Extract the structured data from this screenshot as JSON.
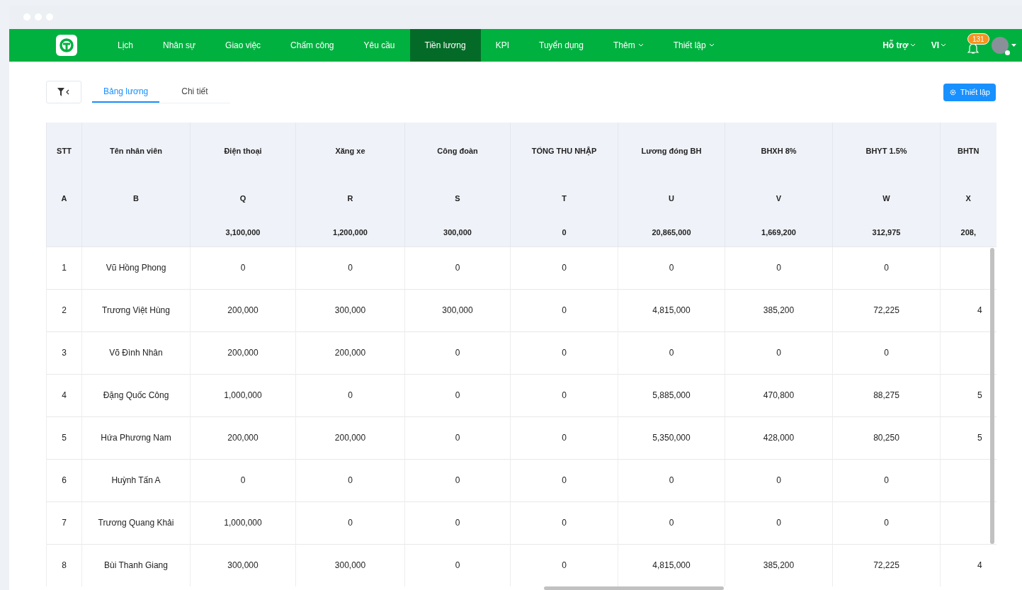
{
  "nav": {
    "items": [
      {
        "label": "Lịch",
        "selected": false,
        "has_menu": false
      },
      {
        "label": "Nhân sự",
        "selected": false,
        "has_menu": false
      },
      {
        "label": "Giao việc",
        "selected": false,
        "has_menu": false
      },
      {
        "label": "Chấm công",
        "selected": false,
        "has_menu": false
      },
      {
        "label": "Yêu cầu",
        "selected": false,
        "has_menu": false
      },
      {
        "label": "Tiền lương",
        "selected": true,
        "has_menu": false
      },
      {
        "label": "KPI",
        "selected": false,
        "has_menu": false
      },
      {
        "label": "Tuyển dụng",
        "selected": false,
        "has_menu": false
      },
      {
        "label": "Thêm",
        "selected": false,
        "has_menu": true
      },
      {
        "label": "Thiết lập",
        "selected": false,
        "has_menu": true
      }
    ],
    "right": [
      {
        "label": "Hỗ trợ"
      },
      {
        "label": "VI"
      }
    ],
    "notification_count": "131"
  },
  "tabs": [
    {
      "label": "Bảng lương",
      "selected": true
    },
    {
      "label": "Chi tiết",
      "selected": false
    }
  ],
  "settings_button": "Thiết lập",
  "table": {
    "columns": [
      {
        "title": "STT",
        "letter": "A"
      },
      {
        "title": "Tên nhân viên",
        "letter": "B"
      },
      {
        "title": "Điện thoại",
        "letter": "Q",
        "total": "3,100,000"
      },
      {
        "title": "Xăng xe",
        "letter": "R",
        "total": "1,200,000"
      },
      {
        "title": "Công đoàn",
        "letter": "S",
        "total": "300,000"
      },
      {
        "title": "TỔNG THU NHẬP",
        "letter": "T",
        "total": "0"
      },
      {
        "title": "Lương đóng BH",
        "letter": "U",
        "total": "20,865,000"
      },
      {
        "title": "BHXH 8%",
        "letter": "V",
        "total": "1,669,200"
      },
      {
        "title": "BHYT 1.5%",
        "letter": "W",
        "total": "312,975"
      },
      {
        "title": "BHTN",
        "letter": "X",
        "total": "208,"
      }
    ],
    "rows": [
      [
        "1",
        "Vũ Hồng Phong",
        "0",
        "0",
        "0",
        "0",
        "0",
        "0",
        "0",
        null
      ],
      [
        "2",
        "Trương Việt Hùng",
        "200,000",
        "300,000",
        "300,000",
        "0",
        "4,815,000",
        "385,200",
        "72,225",
        "4"
      ],
      [
        "3",
        "Võ Đình Nhân",
        "200,000",
        "200,000",
        "0",
        "0",
        "0",
        "0",
        "0",
        null
      ],
      [
        "4",
        "Đặng Quốc Công",
        "1,000,000",
        "0",
        "0",
        "0",
        "5,885,000",
        "470,800",
        "88,275",
        "5"
      ],
      [
        "5",
        "Hứa Phương Nam",
        "200,000",
        "200,000",
        "0",
        "0",
        "5,350,000",
        "428,000",
        "80,250",
        "5"
      ],
      [
        "6",
        "Huỳnh Tấn A",
        "0",
        "0",
        "0",
        "0",
        "0",
        "0",
        "0",
        null
      ],
      [
        "7",
        "Trương Quang Khải",
        "1,000,000",
        "0",
        "0",
        "0",
        "0",
        "0",
        "0",
        null
      ],
      [
        "8",
        "Bùi Thanh Giang",
        "300,000",
        "300,000",
        "0",
        "0",
        "4,815,000",
        "385,200",
        "72,225",
        "4"
      ]
    ]
  }
}
